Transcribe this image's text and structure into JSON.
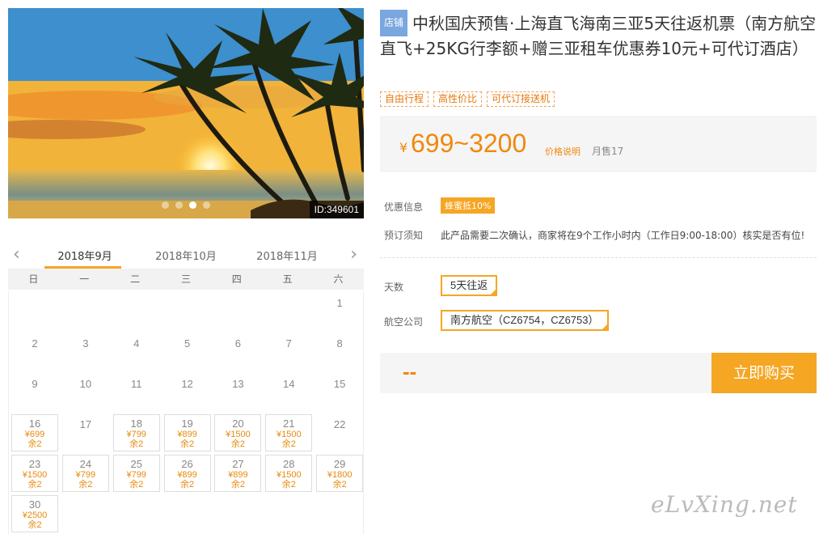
{
  "photo": {
    "id_label": "ID:349601"
  },
  "calendar": {
    "months": [
      "2018年9月",
      "2018年10月",
      "2018年11月"
    ],
    "weekdays": [
      "日",
      "一",
      "二",
      "三",
      "四",
      "五",
      "六"
    ],
    "days": [
      {
        "day": "1"
      },
      {
        "day": "2"
      },
      {
        "day": "3"
      },
      {
        "day": "4"
      },
      {
        "day": "5"
      },
      {
        "day": "6"
      },
      {
        "day": "7"
      },
      {
        "day": "8"
      },
      {
        "day": "9"
      },
      {
        "day": "10"
      },
      {
        "day": "11"
      },
      {
        "day": "12"
      },
      {
        "day": "13"
      },
      {
        "day": "14"
      },
      {
        "day": "15"
      },
      {
        "day": "16",
        "price": "¥699",
        "stock": "余2"
      },
      {
        "day": "17"
      },
      {
        "day": "18",
        "price": "¥799",
        "stock": "余2"
      },
      {
        "day": "19",
        "price": "¥899",
        "stock": "余2"
      },
      {
        "day": "20",
        "price": "¥1500",
        "stock": "余2"
      },
      {
        "day": "21",
        "price": "¥1500",
        "stock": "余2"
      },
      {
        "day": "22"
      },
      {
        "day": "23",
        "price": "¥1500",
        "stock": "余2"
      },
      {
        "day": "24",
        "price": "¥799",
        "stock": "余2"
      },
      {
        "day": "25",
        "price": "¥799",
        "stock": "余2"
      },
      {
        "day": "26",
        "price": "¥899",
        "stock": "余2"
      },
      {
        "day": "27",
        "price": "¥899",
        "stock": "余2"
      },
      {
        "day": "28",
        "price": "¥1500",
        "stock": "余2"
      },
      {
        "day": "29",
        "price": "¥1800",
        "stock": "余2"
      },
      {
        "day": "30",
        "price": "¥2500",
        "stock": "余2"
      }
    ]
  },
  "product": {
    "shop_tag": "店铺",
    "title": "中秋国庆预售·上海直飞海南三亚5天往返机票（南方航空直飞+25KG行李额+赠三亚租车优惠券10元+可代订酒店）",
    "tags": [
      "自由行程",
      "高性价比",
      "可代订接送机"
    ],
    "currency": "¥",
    "price_range": "699~3200",
    "price_explain": "价格说明",
    "monthly_sales": "月售17",
    "promo_label": "优惠信息",
    "promo_badge": "蜂蜜抵10%",
    "notice_label": "预订须知",
    "notice_text": "此产品需要二次确认，商家将在9个工作小时内（工作日9:00-18:00）核实是否有位!",
    "days_label": "天数",
    "days_option": "5天往返",
    "airline_label": "航空公司",
    "airline_option": "南方航空（CZ6754，CZ6753）",
    "total_placeholder": "--",
    "buy_label": "立即购买"
  },
  "watermark": "eLvXing.net",
  "colors": {
    "accent": "#f5a623",
    "price": "#f0880c",
    "shop_tag": "#7aa7e0"
  }
}
